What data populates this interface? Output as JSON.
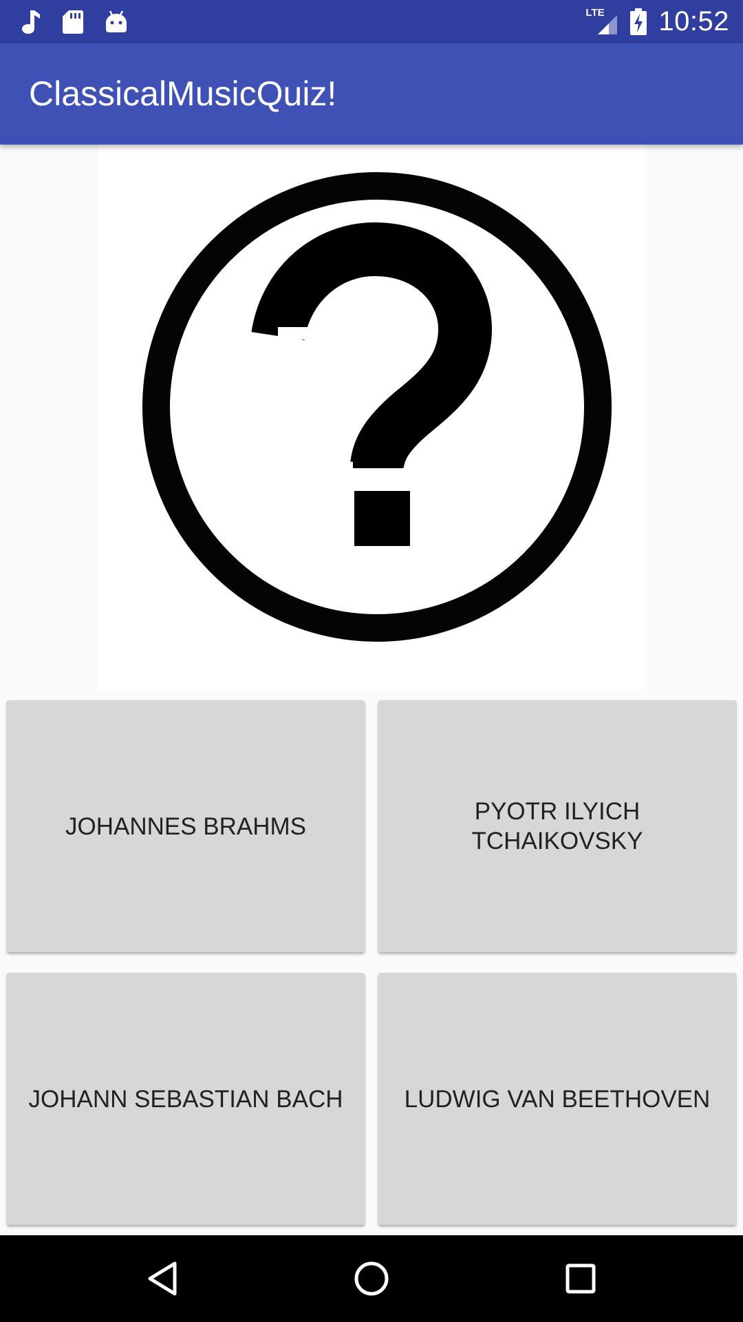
{
  "status_bar": {
    "time": "10:52",
    "network_label": "LTE",
    "icons": [
      "music-note-icon",
      "sd-card-icon",
      "android-icon",
      "lte-signal-icon",
      "battery-charging-icon"
    ]
  },
  "app_bar": {
    "title": "ClassicalMusicQuiz!"
  },
  "quiz": {
    "image_icon": "question-mark-circle-icon",
    "answers": [
      "JOHANNES BRAHMS",
      "PYOTR ILYICH TCHAIKOVSKY",
      "JOHANN SEBASTIAN BACH",
      "LUDWIG VAN BEETHOVEN"
    ]
  },
  "nav_bar": {
    "icons": [
      "back-icon",
      "home-icon",
      "recents-icon"
    ]
  },
  "colors": {
    "status_bar": "#303f9f",
    "app_bar": "#3f51b5",
    "background": "#fafafa",
    "button": "#d6d7d7",
    "button_text": "#212121",
    "nav_bar": "#000000"
  }
}
